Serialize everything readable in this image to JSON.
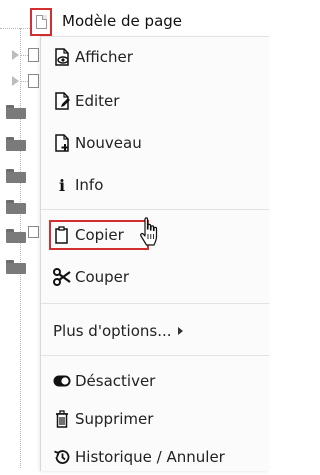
{
  "header": {
    "title": "Modèle de page"
  },
  "menu": {
    "items": [
      {
        "label": "Afficher",
        "icon": "view-page-icon"
      },
      {
        "label": "Editer",
        "icon": "edit-page-icon"
      },
      {
        "label": "Nouveau",
        "icon": "new-page-icon"
      },
      {
        "label": "Info",
        "icon": "info-icon"
      },
      {
        "label": "Copier",
        "icon": "copy-icon"
      },
      {
        "label": "Couper",
        "icon": "scissors-icon"
      },
      {
        "label": "Plus d'options...",
        "icon": "caret-right-icon"
      },
      {
        "label": "Désactiver",
        "icon": "toggle-off-icon"
      },
      {
        "label": "Supprimer",
        "icon": "trash-icon"
      },
      {
        "label": "Historique / Annuler",
        "icon": "history-icon"
      }
    ]
  },
  "colors": {
    "highlight": "#d32f2f",
    "menu_bg": "#fbfbfb"
  }
}
